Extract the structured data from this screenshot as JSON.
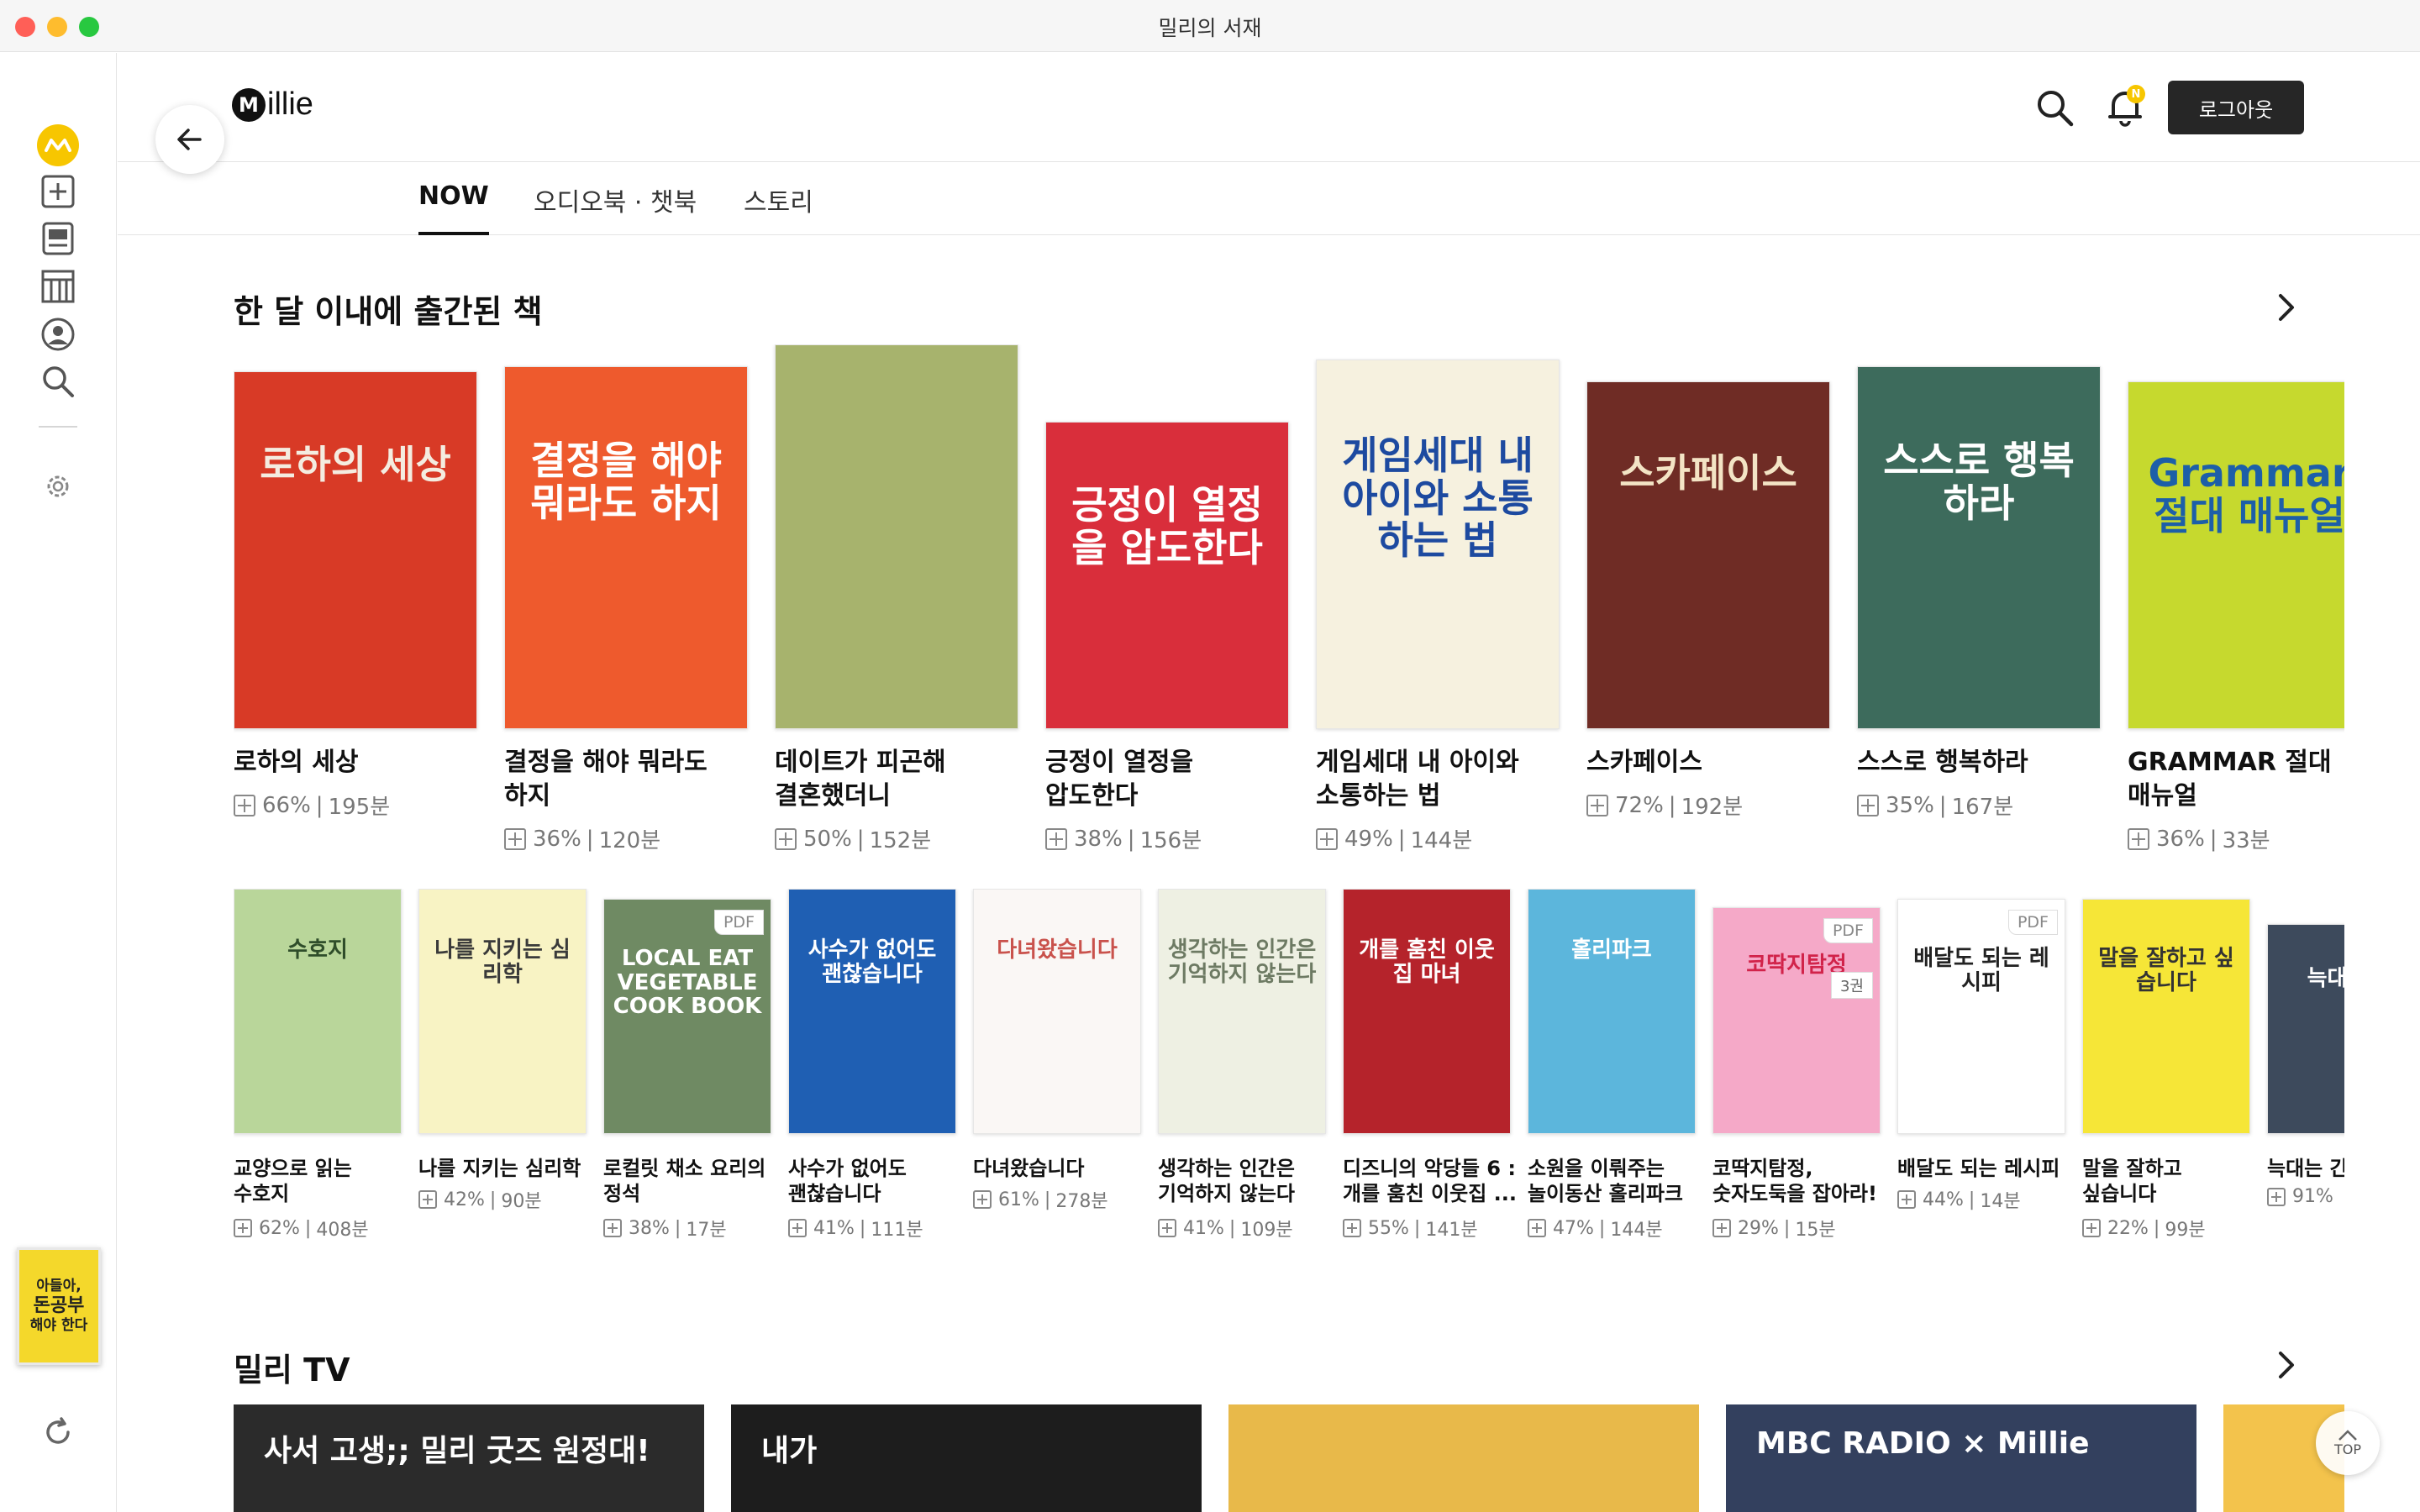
{
  "window": {
    "title": "밀리의 서재"
  },
  "brand": {
    "name": "illie",
    "mark": "M"
  },
  "header": {
    "logout_label": "로그아웃",
    "notification_badge": "N"
  },
  "tabs": [
    {
      "label": "NOW",
      "active": true
    },
    {
      "label": "오디오북 · 챗북",
      "active": false
    },
    {
      "label": "스토리",
      "active": false
    }
  ],
  "sidebar": {
    "items": [
      {
        "icon": "millie-logo-icon"
      },
      {
        "icon": "add-library-icon"
      },
      {
        "icon": "book-feed-icon"
      },
      {
        "icon": "bookshelf-icon"
      },
      {
        "icon": "profile-icon"
      },
      {
        "icon": "search-icon"
      },
      {
        "icon": "settings-icon"
      },
      {
        "icon": "refresh-icon"
      }
    ],
    "promo_book": {
      "line1": "아들아,",
      "line2": "돈공부",
      "line3": "해야 한다"
    }
  },
  "section_new": {
    "title": "한 달 이내에 출간된 책",
    "books": [
      {
        "title": "로하의 세상",
        "percent": "66%",
        "minutes": "195분",
        "cover_bg": "#d83a26",
        "cover_fg": "#f4ece0",
        "cover_text": "로하의 세상"
      },
      {
        "title": "결정을 해야 뭐라도 하지",
        "percent": "36%",
        "minutes": "120분",
        "cover_bg": "#ee5a2d",
        "cover_fg": "#ffffff",
        "cover_text": "결정을 해야 뭐라도 하지"
      },
      {
        "title": "데이트가 피곤해 결혼했더니",
        "percent": "50%",
        "minutes": "152분",
        "cover_bg": "#a7b36d",
        "cover_fg": "#ffffff",
        "cover_text": ""
      },
      {
        "title": "긍정이 열정을 압도한다",
        "percent": "38%",
        "minutes": "156분",
        "cover_bg": "#d92e3b",
        "cover_fg": "#ffffff",
        "cover_text": "긍정이 열정을 압도한다"
      },
      {
        "title": "게임세대 내 아이와 소통하는 법",
        "percent": "49%",
        "minutes": "144분",
        "cover_bg": "#f6f1df",
        "cover_fg": "#1d4aa0",
        "cover_text": "게임세대 내 아이와 소통하는 법"
      },
      {
        "title": "스카페이스",
        "percent": "72%",
        "minutes": "192분",
        "cover_bg": "#6f2c25",
        "cover_fg": "#f3e4c5",
        "cover_text": "스카페이스"
      },
      {
        "title": "스스로 행복하라",
        "percent": "35%",
        "minutes": "167분",
        "cover_bg": "#3d6b5c",
        "cover_fg": "#ffffff",
        "cover_text": "스스로 행복하라"
      },
      {
        "title": "GRAMMAR 절대 매뉴얼",
        "percent": "36%",
        "minutes": "33분",
        "cover_bg": "#c6d92e",
        "cover_fg": "#1d5fa8",
        "cover_text": "Grammar 절대 매뉴얼"
      }
    ]
  },
  "section_new_row2": {
    "books": [
      {
        "title": "교양으로 읽는 수호지",
        "percent": "62%",
        "minutes": "408분",
        "cover_bg": "#b9d69a",
        "cover_fg": "#2f4d2a",
        "cover_text": "수호지",
        "pdf": false
      },
      {
        "title": "나를 지키는 심리학",
        "percent": "42%",
        "minutes": "90분",
        "cover_bg": "#f8f3c4",
        "cover_fg": "#3a3a3a",
        "cover_text": "나를 지키는 심리학",
        "pdf": false
      },
      {
        "title": "로컬릿 채소 요리의 정석",
        "percent": "38%",
        "minutes": "17분",
        "cover_bg": "#6f8a63",
        "cover_fg": "#ffffff",
        "cover_text": "LOCAL EAT VEGETABLE COOK BOOK",
        "pdf": true,
        "pdf_label": "PDF"
      },
      {
        "title": "사수가 없어도 괜찮습니다",
        "percent": "41%",
        "minutes": "111분",
        "cover_bg": "#1f5fb3",
        "cover_fg": "#ffffff",
        "cover_text": "사수가 없어도 괜찮습니다",
        "pdf": false
      },
      {
        "title": "다녀왔습니다",
        "percent": "61%",
        "minutes": "278분",
        "cover_bg": "#faf7f5",
        "cover_fg": "#c9524c",
        "cover_text": "다녀왔습니다",
        "pdf": false
      },
      {
        "title": "생각하는 인간은 기억하지 않는다",
        "percent": "41%",
        "minutes": "109분",
        "cover_bg": "#eef0e3",
        "cover_fg": "#6d7a63",
        "cover_text": "생각하는 인간은 기억하지 않는다",
        "pdf": false
      },
      {
        "title": "디즈니의 악당들 6 : 개를 훔친 이웃집 ...",
        "percent": "55%",
        "minutes": "141분",
        "cover_bg": "#b5232b",
        "cover_fg": "#ffffff",
        "cover_text": "개를 훔친 이웃집 마녀",
        "pdf": false
      },
      {
        "title": "소원을 이뤄주는 놀이동산 홀리파크",
        "percent": "47%",
        "minutes": "144분",
        "cover_bg": "#5cb6dc",
        "cover_fg": "#ffffff",
        "cover_text": "홀리파크",
        "pdf": false
      },
      {
        "title": "코딱지탐정, 숫자도둑을 잡아라!",
        "percent": "29%",
        "minutes": "15분",
        "cover_bg": "#f5a9c8",
        "cover_fg": "#d1234a",
        "cover_text": "코딱지탐정",
        "pdf": true,
        "pdf_label": "PDF",
        "volume": "3권"
      },
      {
        "title": "배달도 되는 레시피",
        "percent": "44%",
        "minutes": "14분",
        "cover_bg": "#ffffff",
        "cover_fg": "#222222",
        "cover_text": "배달도 되는 레시피",
        "pdf": true,
        "pdf_label": "PDF"
      },
      {
        "title": "말을 잘하고 싶습니다",
        "percent": "22%",
        "minutes": "99분",
        "cover_bg": "#f6e637",
        "cover_fg": "#333333",
        "cover_text": "말을 잘하고 싶습니다",
        "pdf": false
      },
      {
        "title": "늑대는 간 않아",
        "percent": "91%",
        "minutes": "",
        "cover_bg": "#3d4a5c",
        "cover_fg": "#ffffff",
        "cover_text": "늑대는 간",
        "pdf": false
      }
    ]
  },
  "section_tv": {
    "title": "밀리 TV",
    "items": [
      {
        "headline": "사서 고생;; 밀리 굿즈 원정대!",
        "bg": "#2b2b2b"
      },
      {
        "headline": "내가",
        "bg": "#1d1d1d"
      },
      {
        "headline": "",
        "bg": "#e8b94a"
      },
      {
        "headline": "MBC RADIO × Millie",
        "bg": "#33405e"
      },
      {
        "headline": "",
        "bg": "#f3c34c"
      }
    ]
  },
  "top_button": {
    "label": "TOP"
  }
}
